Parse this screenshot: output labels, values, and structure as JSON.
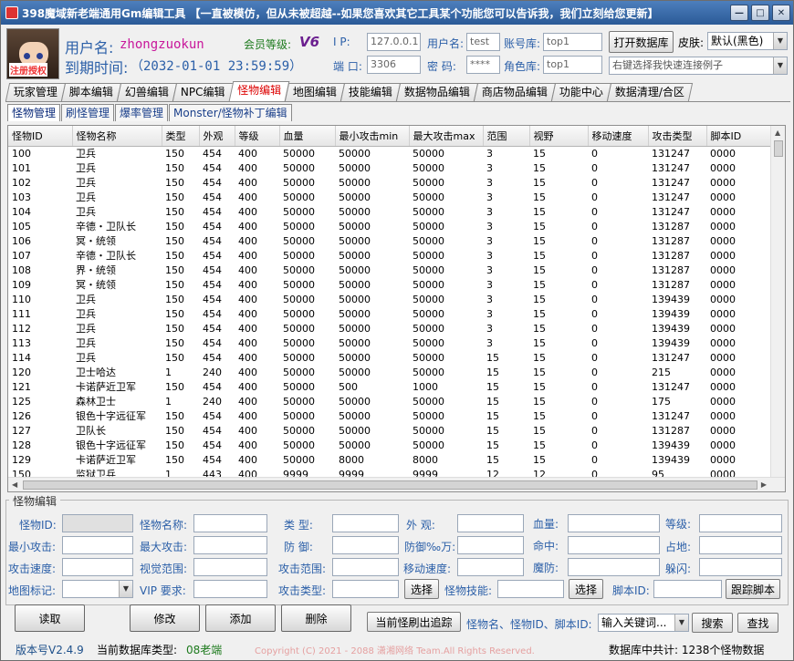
{
  "window": {
    "title": "398魔域新老端通用Gm编辑工具 【一直被模仿，但从未被超越--如果您喜欢其它工具某个功能您可以告诉我，我们立刻给您更新】",
    "min_label": "—",
    "max_label": "□",
    "close_label": "✕"
  },
  "avatar": {
    "register_text": "注册授权"
  },
  "user": {
    "username_label": "用户名:",
    "username": "zhongzuokun",
    "expire_label": "到期时间:",
    "expire": "（2032-01-01 23:59:59）",
    "vip_label": "会员等级:",
    "vip_badge": "V6"
  },
  "connection": {
    "ip_label": "I  P:",
    "ip": "127.0.0.1",
    "port_label": "端  口:",
    "port": "3306",
    "user_label": "用户名:",
    "user": "test",
    "pwd_label": "密  码:",
    "pwd": "****",
    "account_db_label": "账号库:",
    "account_db": "top1",
    "role_db_label": "角色库:",
    "role_db": "top1",
    "open_db_button": "打开数据库",
    "skin_label": "皮肤:",
    "skin_value": "默认(黑色)",
    "example_hint": "右键选择我快速连接例子"
  },
  "main_tabs": [
    {
      "label": "玩家管理",
      "active": false
    },
    {
      "label": "脚本编辑",
      "active": false
    },
    {
      "label": "幻兽编辑",
      "active": false
    },
    {
      "label": "NPC编辑",
      "active": false
    },
    {
      "label": "怪物编辑",
      "active": true
    },
    {
      "label": "地图编辑",
      "active": false
    },
    {
      "label": "技能编辑",
      "active": false
    },
    {
      "label": "数据物品编辑",
      "active": false
    },
    {
      "label": "商店物品编辑",
      "active": false
    },
    {
      "label": "功能中心",
      "active": false
    },
    {
      "label": "数据清理/合区",
      "active": false
    }
  ],
  "sub_tabs": [
    {
      "label": "怪物管理",
      "active": true
    },
    {
      "label": "刷怪管理",
      "active": false
    },
    {
      "label": "爆率管理",
      "active": false
    },
    {
      "label": "Monster/怪物补丁编辑",
      "active": false
    }
  ],
  "table": {
    "columns": [
      "怪物ID",
      "怪物名称",
      "类型",
      "外观",
      "等级",
      "血量",
      "最小攻击min",
      "最大攻击max",
      "范围",
      "视野",
      "移动速度",
      "攻击类型",
      "脚本ID"
    ],
    "rows": [
      [
        "100",
        "卫兵",
        "150",
        "454",
        "400",
        "50000",
        "50000",
        "50000",
        "3",
        "15",
        "0",
        "131247",
        "0000"
      ],
      [
        "101",
        "卫兵",
        "150",
        "454",
        "400",
        "50000",
        "50000",
        "50000",
        "3",
        "15",
        "0",
        "131247",
        "0000"
      ],
      [
        "102",
        "卫兵",
        "150",
        "454",
        "400",
        "50000",
        "50000",
        "50000",
        "3",
        "15",
        "0",
        "131247",
        "0000"
      ],
      [
        "103",
        "卫兵",
        "150",
        "454",
        "400",
        "50000",
        "50000",
        "50000",
        "3",
        "15",
        "0",
        "131247",
        "0000"
      ],
      [
        "104",
        "卫兵",
        "150",
        "454",
        "400",
        "50000",
        "50000",
        "50000",
        "3",
        "15",
        "0",
        "131247",
        "0000"
      ],
      [
        "105",
        "辛德・卫队长",
        "150",
        "454",
        "400",
        "50000",
        "50000",
        "50000",
        "3",
        "15",
        "0",
        "131287",
        "0000"
      ],
      [
        "106",
        "冥・统领",
        "150",
        "454",
        "400",
        "50000",
        "50000",
        "50000",
        "3",
        "15",
        "0",
        "131287",
        "0000"
      ],
      [
        "107",
        "辛德・卫队长",
        "150",
        "454",
        "400",
        "50000",
        "50000",
        "50000",
        "3",
        "15",
        "0",
        "131287",
        "0000"
      ],
      [
        "108",
        "界・统领",
        "150",
        "454",
        "400",
        "50000",
        "50000",
        "50000",
        "3",
        "15",
        "0",
        "131287",
        "0000"
      ],
      [
        "109",
        "冥・统领",
        "150",
        "454",
        "400",
        "50000",
        "50000",
        "50000",
        "3",
        "15",
        "0",
        "131287",
        "0000"
      ],
      [
        "110",
        "卫兵",
        "150",
        "454",
        "400",
        "50000",
        "50000",
        "50000",
        "3",
        "15",
        "0",
        "139439",
        "0000"
      ],
      [
        "111",
        "卫兵",
        "150",
        "454",
        "400",
        "50000",
        "50000",
        "50000",
        "3",
        "15",
        "0",
        "139439",
        "0000"
      ],
      [
        "112",
        "卫兵",
        "150",
        "454",
        "400",
        "50000",
        "50000",
        "50000",
        "3",
        "15",
        "0",
        "139439",
        "0000"
      ],
      [
        "113",
        "卫兵",
        "150",
        "454",
        "400",
        "50000",
        "50000",
        "50000",
        "3",
        "15",
        "0",
        "139439",
        "0000"
      ],
      [
        "114",
        "卫兵",
        "150",
        "454",
        "400",
        "50000",
        "50000",
        "50000",
        "15",
        "15",
        "0",
        "131247",
        "0000"
      ],
      [
        "120",
        "卫士哈达",
        "1",
        "240",
        "400",
        "50000",
        "50000",
        "50000",
        "15",
        "15",
        "0",
        "215",
        "0000"
      ],
      [
        "121",
        "卡诺萨近卫军",
        "150",
        "454",
        "400",
        "50000",
        "500",
        "1000",
        "15",
        "15",
        "0",
        "131247",
        "0000"
      ],
      [
        "125",
        "森林卫士",
        "1",
        "240",
        "400",
        "50000",
        "50000",
        "50000",
        "15",
        "15",
        "0",
        "175",
        "0000"
      ],
      [
        "126",
        "银色十字远征军",
        "150",
        "454",
        "400",
        "50000",
        "50000",
        "50000",
        "15",
        "15",
        "0",
        "131247",
        "0000"
      ],
      [
        "127",
        "卫队长",
        "150",
        "454",
        "400",
        "50000",
        "50000",
        "50000",
        "15",
        "15",
        "0",
        "131287",
        "0000"
      ],
      [
        "128",
        "银色十字远征军",
        "150",
        "454",
        "400",
        "50000",
        "50000",
        "50000",
        "15",
        "15",
        "0",
        "139439",
        "0000"
      ],
      [
        "129",
        "卡诺萨近卫军",
        "150",
        "454",
        "400",
        "50000",
        "8000",
        "8000",
        "15",
        "15",
        "0",
        "139439",
        "0000"
      ],
      [
        "150",
        "监狱卫兵",
        "1",
        "443",
        "400",
        "9999",
        "9999",
        "9999",
        "12",
        "12",
        "0",
        "95",
        "0000"
      ]
    ]
  },
  "edit": {
    "group_title": "怪物编辑",
    "id_label": "怪物ID:",
    "name_label": "怪物名称:",
    "type_label": "类  型:",
    "look_label": "外  观:",
    "hp_label": "血量:",
    "level_label": "等级:",
    "min_atk_label": "最小攻击:",
    "max_atk_label": "最大攻击:",
    "defense_label": "防  御:",
    "defense_pct_label": "防御‰万:",
    "hit_label": "命中:",
    "size_label": "占地:",
    "atk_speed_label": "攻击速度:",
    "view_range_label": "视觉范围:",
    "atk_range_label": "攻击范围:",
    "move_speed_label": "移动速度:",
    "magic_def_label": "魔防:",
    "dodge_label": "躲闪:",
    "map_tag_label": "地图标记:",
    "vip_req_label": "VIP 要求:",
    "atk_type_label": "攻击类型:",
    "select_button": "选择",
    "skill_label": "怪物技能:",
    "select_button2": "选择",
    "script_id_label": "脚本ID:",
    "trace_script_button": "跟踪脚本"
  },
  "actions": {
    "read": "读取",
    "modify": "修改",
    "add": "添加",
    "delete": "删除",
    "trace_spawn": "当前怪刷出追踪",
    "search_by_label": "怪物名、怪物ID、脚本ID:",
    "keyword_placeholder": "输入关键词...",
    "search": "搜索",
    "find": "查找"
  },
  "status": {
    "version": "版本号V2.4.9",
    "db_type_label": "当前数据库类型:",
    "db_type": "08老端",
    "copyright": "Copyright (C) 2021 - 2088 潇湘网络 Team.All Rights Reserved.",
    "count_text": "数据库中共计: 1238个怪物数据"
  },
  "colors": {
    "title_bar": "#2b5a97",
    "label_blue": "#2b5fa8",
    "active_tab_text": "#dd0000",
    "username_color": "#c8179b",
    "vip_color": "#6b1f8f",
    "copyright_color": "#e5a0a0",
    "db_type_color": "#1d7a1d"
  }
}
